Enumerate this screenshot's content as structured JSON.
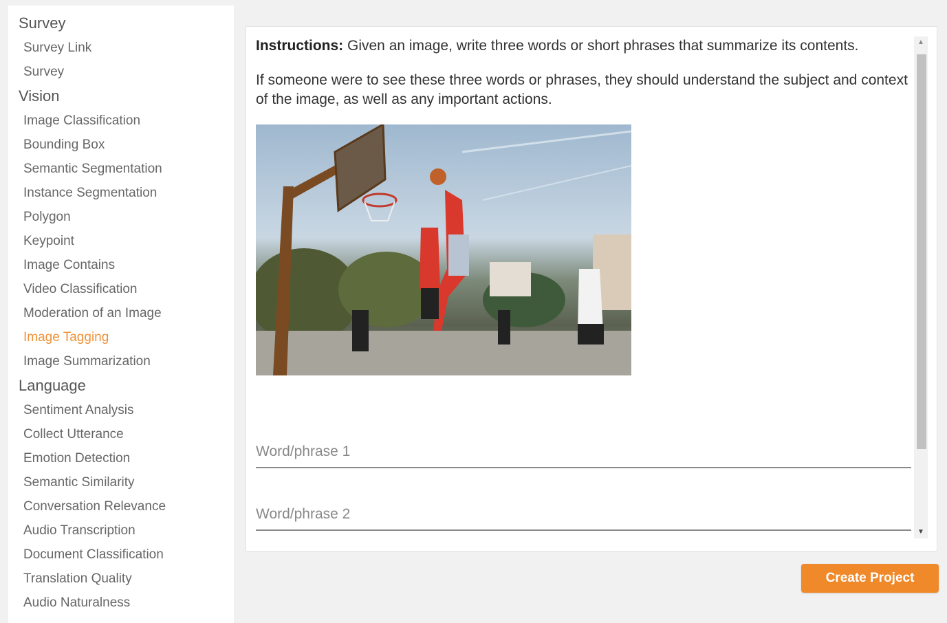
{
  "sidebar": {
    "sections": [
      {
        "title": "Survey",
        "items": [
          "Survey Link",
          "Survey"
        ]
      },
      {
        "title": "Vision",
        "items": [
          "Image Classification",
          "Bounding Box",
          "Semantic Segmentation",
          "Instance Segmentation",
          "Polygon",
          "Keypoint",
          "Image Contains",
          "Video Classification",
          "Moderation of an Image",
          "Image Tagging",
          "Image Summarization"
        ]
      },
      {
        "title": "Language",
        "items": [
          "Sentiment Analysis",
          "Collect Utterance",
          "Emotion Detection",
          "Semantic Similarity",
          "Conversation Relevance",
          "Audio Transcription",
          "Document Classification",
          "Translation Quality",
          "Audio Naturalness"
        ]
      }
    ],
    "active_item": "Image Tagging"
  },
  "task": {
    "instructions_label": "Instructions:",
    "instructions_text": " Given an image, write three words or short phrases that summarize its contents.",
    "guidance": "If someone were to see these three words or phrases, they should understand the subject and context of the image, as well as any important actions.",
    "field1_placeholder": "Word/phrase 1",
    "field2_placeholder": "Word/phrase 2"
  },
  "actions": {
    "create_label": "Create Project"
  },
  "colors": {
    "accent": "#f0892a",
    "active_nav": "#f0923a"
  }
}
